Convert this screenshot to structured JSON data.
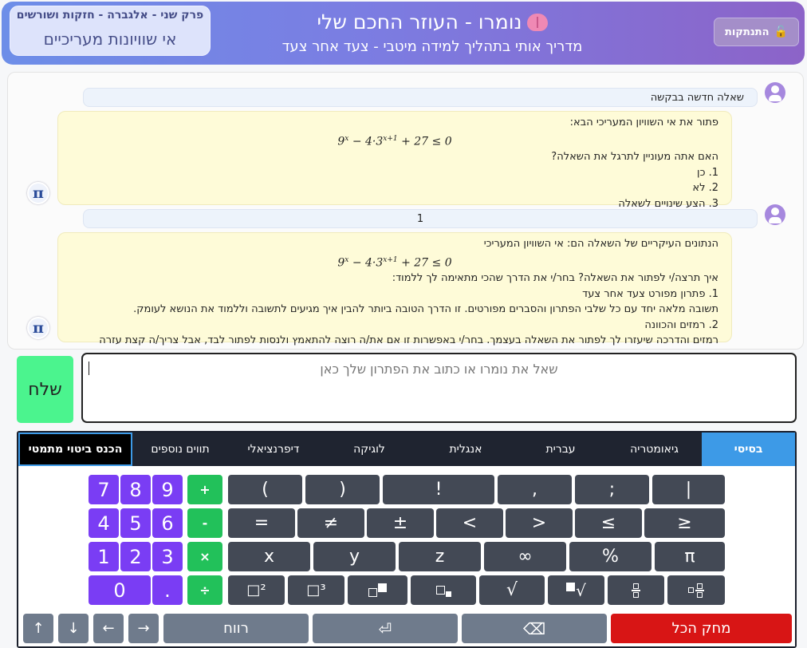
{
  "header": {
    "logout_label": "התנתקות",
    "title": "נומרו - העוזר החכם שלי",
    "subtitle": "מדריך אותי בתהליך למידה מיטבי - צעד אחר צעד",
    "chapter_top": "פרק שני - אלגברה - חזקות ושורשים",
    "chapter_bottom": "אי שוויונות מעריכיים"
  },
  "chat": {
    "msg1": "שאלה חדשה בבקשה",
    "bot1": {
      "line1": "פתור את אי השוויון המעריכי הבא:",
      "math": "9ˣ − 4·3ˣ⁺¹ + 27 ≤ 0",
      "line2": "האם אתה מעוניין לתרגל את השאלה?",
      "opt1": "1. כן",
      "opt2": "2. לא",
      "opt3": "3. הצע שינויים לשאלה"
    },
    "msg2": "1",
    "bot2": {
      "line1": "הנתונים העיקריים של השאלה הם: אי השוויון המעריכי",
      "math": "9ˣ − 4·3ˣ⁺¹ + 27 ≤ 0",
      "line2": "איך תרצה/י לפתור את השאלה? בחר/י את הדרך שהכי מתאימה לך ללמוד:",
      "line3": "1. פתרון מפורט צעד אחר צעד",
      "line4": "תשובה מלאה יחד עם כל שלבי הפתרון והסברים מפורטים. זו הדרך הטובה ביותר להבין איך מגיעים לתשובה וללמוד את הנושא לעומק.",
      "line5": "2. רמזים והכוונה",
      "line6": "רמזים והדרכה שיעזרו לך לפתור את השאלה בעצמך. בחר/י באפשרות זו אם את/ה רוצה להתאמץ ולנסות לפתור לבד, אבל צריך/ה קצת עזרה בדרך."
    },
    "bot_avatar": "π"
  },
  "input": {
    "placeholder": "שאל את נומרו או כתוב את הפתרון שלך כאן",
    "send_label": "שלח"
  },
  "keyboard": {
    "tabs": [
      "בסיסי",
      "גיאומטריה",
      "עברית",
      "אנגלית",
      "לוגיקה",
      "דיפרנציאלי",
      "תווים נוספים",
      "הכנס ביטוי מתמטי"
    ],
    "row1": [
      "(",
      ")",
      "!",
      ",",
      ";",
      "|"
    ],
    "row2": [
      "=",
      "≠",
      "±",
      "<",
      ">",
      "≤",
      "≥"
    ],
    "row3": [
      "x",
      "y",
      "z",
      "∞",
      "%",
      "π"
    ],
    "row4": [
      "□²",
      "□³",
      "",
      "",
      "√",
      "",
      "",
      ""
    ],
    "ops": [
      "+",
      "-",
      "×",
      "÷"
    ],
    "digits": [
      "7",
      "8",
      "9",
      "4",
      "5",
      "6",
      "1",
      "2",
      "3",
      "0",
      "."
    ],
    "arrows": [
      "↑",
      "↓",
      "←",
      "→"
    ],
    "space": "רווח",
    "enter": "⏎",
    "backspace": "⌫",
    "clear_all": "מחק הכל"
  },
  "colors": {
    "header_start": "#6d8ee8",
    "header_end": "#8c63c8",
    "send": "#4bf48e",
    "active_tab": "#3d9ae7",
    "digit_key": "#7a3df4",
    "op_key": "#22c15a",
    "clear_key": "#d81515"
  }
}
